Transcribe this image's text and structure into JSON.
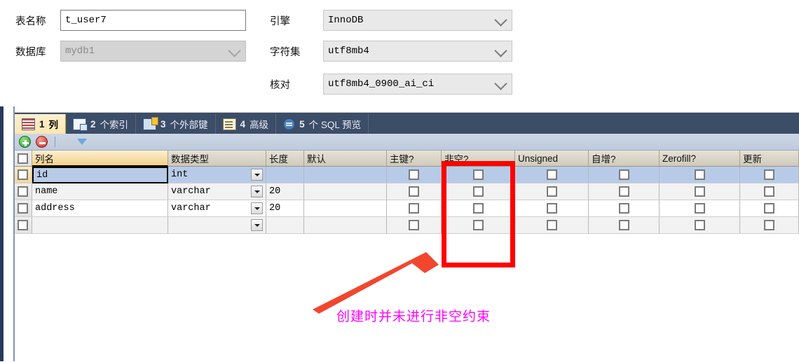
{
  "form": {
    "table_name": {
      "label": "表名称",
      "value": "t_user7"
    },
    "database": {
      "label": "数据库",
      "value": "mydb1",
      "disabled": true
    },
    "engine": {
      "label": "引擎",
      "value": "InnoDB"
    },
    "charset": {
      "label": "字符集",
      "value": "utf8mb4"
    },
    "collation": {
      "label": "核对",
      "value": "utf8mb4_0900_ai_ci"
    }
  },
  "tabs": [
    {
      "num": "1",
      "label": "列",
      "icon": "columns-icon",
      "active": true
    },
    {
      "num": "2",
      "label": "个索引",
      "icon": "index-icon",
      "active": false
    },
    {
      "num": "3",
      "label": "个外部键",
      "icon": "foreign-key-icon",
      "active": false
    },
    {
      "num": "4",
      "label": "高级",
      "icon": "advanced-icon",
      "active": false
    },
    {
      "num": "5",
      "label": "个 SQL 预览",
      "icon": "sql-preview-icon",
      "active": false
    }
  ],
  "toolbar": {
    "add": "add-row-button",
    "delete": "delete-row-button",
    "move_up": "move-up-button",
    "move_down": "move-down-button"
  },
  "grid": {
    "columns": [
      "列名",
      "数据类型",
      "长度",
      "默认",
      "主键?",
      "非空?",
      "Unsigned",
      "自增?",
      "Zerofill?",
      "更新"
    ],
    "highlight_column": "列名",
    "rows": [
      {
        "name": "id",
        "type": "int",
        "length": "",
        "default": "",
        "pk": false,
        "notnull": false,
        "unsigned": false,
        "autoinc": false,
        "zerofill": false,
        "update": false,
        "selected": true
      },
      {
        "name": "name",
        "type": "varchar",
        "length": "20",
        "default": "",
        "pk": false,
        "notnull": false,
        "unsigned": false,
        "autoinc": false,
        "zerofill": false,
        "update": false,
        "selected": false
      },
      {
        "name": "address",
        "type": "varchar",
        "length": "20",
        "default": "",
        "pk": false,
        "notnull": false,
        "unsigned": false,
        "autoinc": false,
        "zerofill": false,
        "update": false,
        "selected": false
      },
      {
        "name": "",
        "type": "",
        "length": "",
        "default": "",
        "pk": false,
        "notnull": false,
        "unsigned": false,
        "autoinc": false,
        "zerofill": false,
        "update": false,
        "selected": false
      }
    ]
  },
  "annotation": {
    "text": "创建时并未进行非空约束",
    "text_color": "#ff00ff",
    "highlight_color": "#ff0000",
    "arrow_color": "#f2462e",
    "highlighted_column": "非空?"
  }
}
